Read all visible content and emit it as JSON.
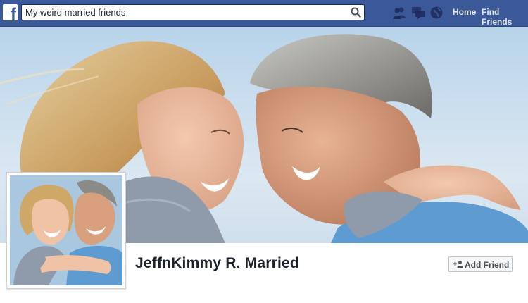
{
  "topbar": {
    "search_value": "My weird married friends",
    "nav": {
      "home": "Home",
      "find_friends": "Find Friends"
    }
  },
  "profile": {
    "name": "JeffnKimmy R. Married",
    "add_friend_label": "Add Friend"
  },
  "colors": {
    "brand_blue": "#3b5998",
    "page_bg": "#e9ebee",
    "button_bg": "#f6f7f9"
  },
  "icons": [
    "facebook-logo-icon",
    "search-icon",
    "friend-requests-icon",
    "messages-icon",
    "notifications-globe-icon",
    "add-friend-icon"
  ]
}
